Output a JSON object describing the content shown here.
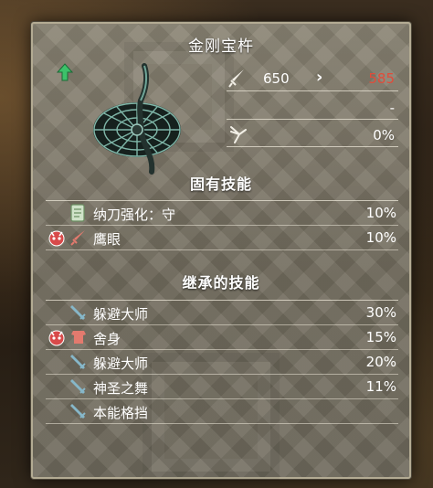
{
  "weapon": {
    "name": "金刚宝杵",
    "stats": [
      {
        "icon": "attack-sword-icon",
        "old": "650",
        "new": "585"
      },
      {
        "icon": "none",
        "old": "",
        "new": "-"
      },
      {
        "icon": "critical-icon",
        "old": "",
        "new": "0%"
      }
    ]
  },
  "inherent": {
    "header": "固有技能",
    "skills": [
      {
        "set_icon": "",
        "icon": "scroll-icon",
        "name": "纳刀强化：守",
        "pct": "10%"
      },
      {
        "set_icon": "oni-mask-icon",
        "icon": "red-blade-icon",
        "name": "鹰眼",
        "pct": "10%"
      }
    ]
  },
  "inherited": {
    "header": "继承的技能",
    "skills": [
      {
        "set_icon": "",
        "icon": "blue-blade-icon",
        "name": "躲避大师",
        "pct": "30%"
      },
      {
        "set_icon": "oni-mask-icon",
        "icon": "red-armor-icon",
        "name": "舍身",
        "pct": "15%"
      },
      {
        "set_icon": "",
        "icon": "blue-blade-icon",
        "name": "躲避大师",
        "pct": "20%"
      },
      {
        "set_icon": "",
        "icon": "blue-blade-icon",
        "name": "神圣之舞",
        "pct": "11%"
      },
      {
        "set_icon": "",
        "icon": "blue-blade-icon",
        "name": "本能格挡",
        "pct": ""
      }
    ]
  },
  "colors": {
    "panel": "#7b7567",
    "stat_decrease": "#e14c3a",
    "rarity": "#3cc26a",
    "text": "#ffffff"
  }
}
